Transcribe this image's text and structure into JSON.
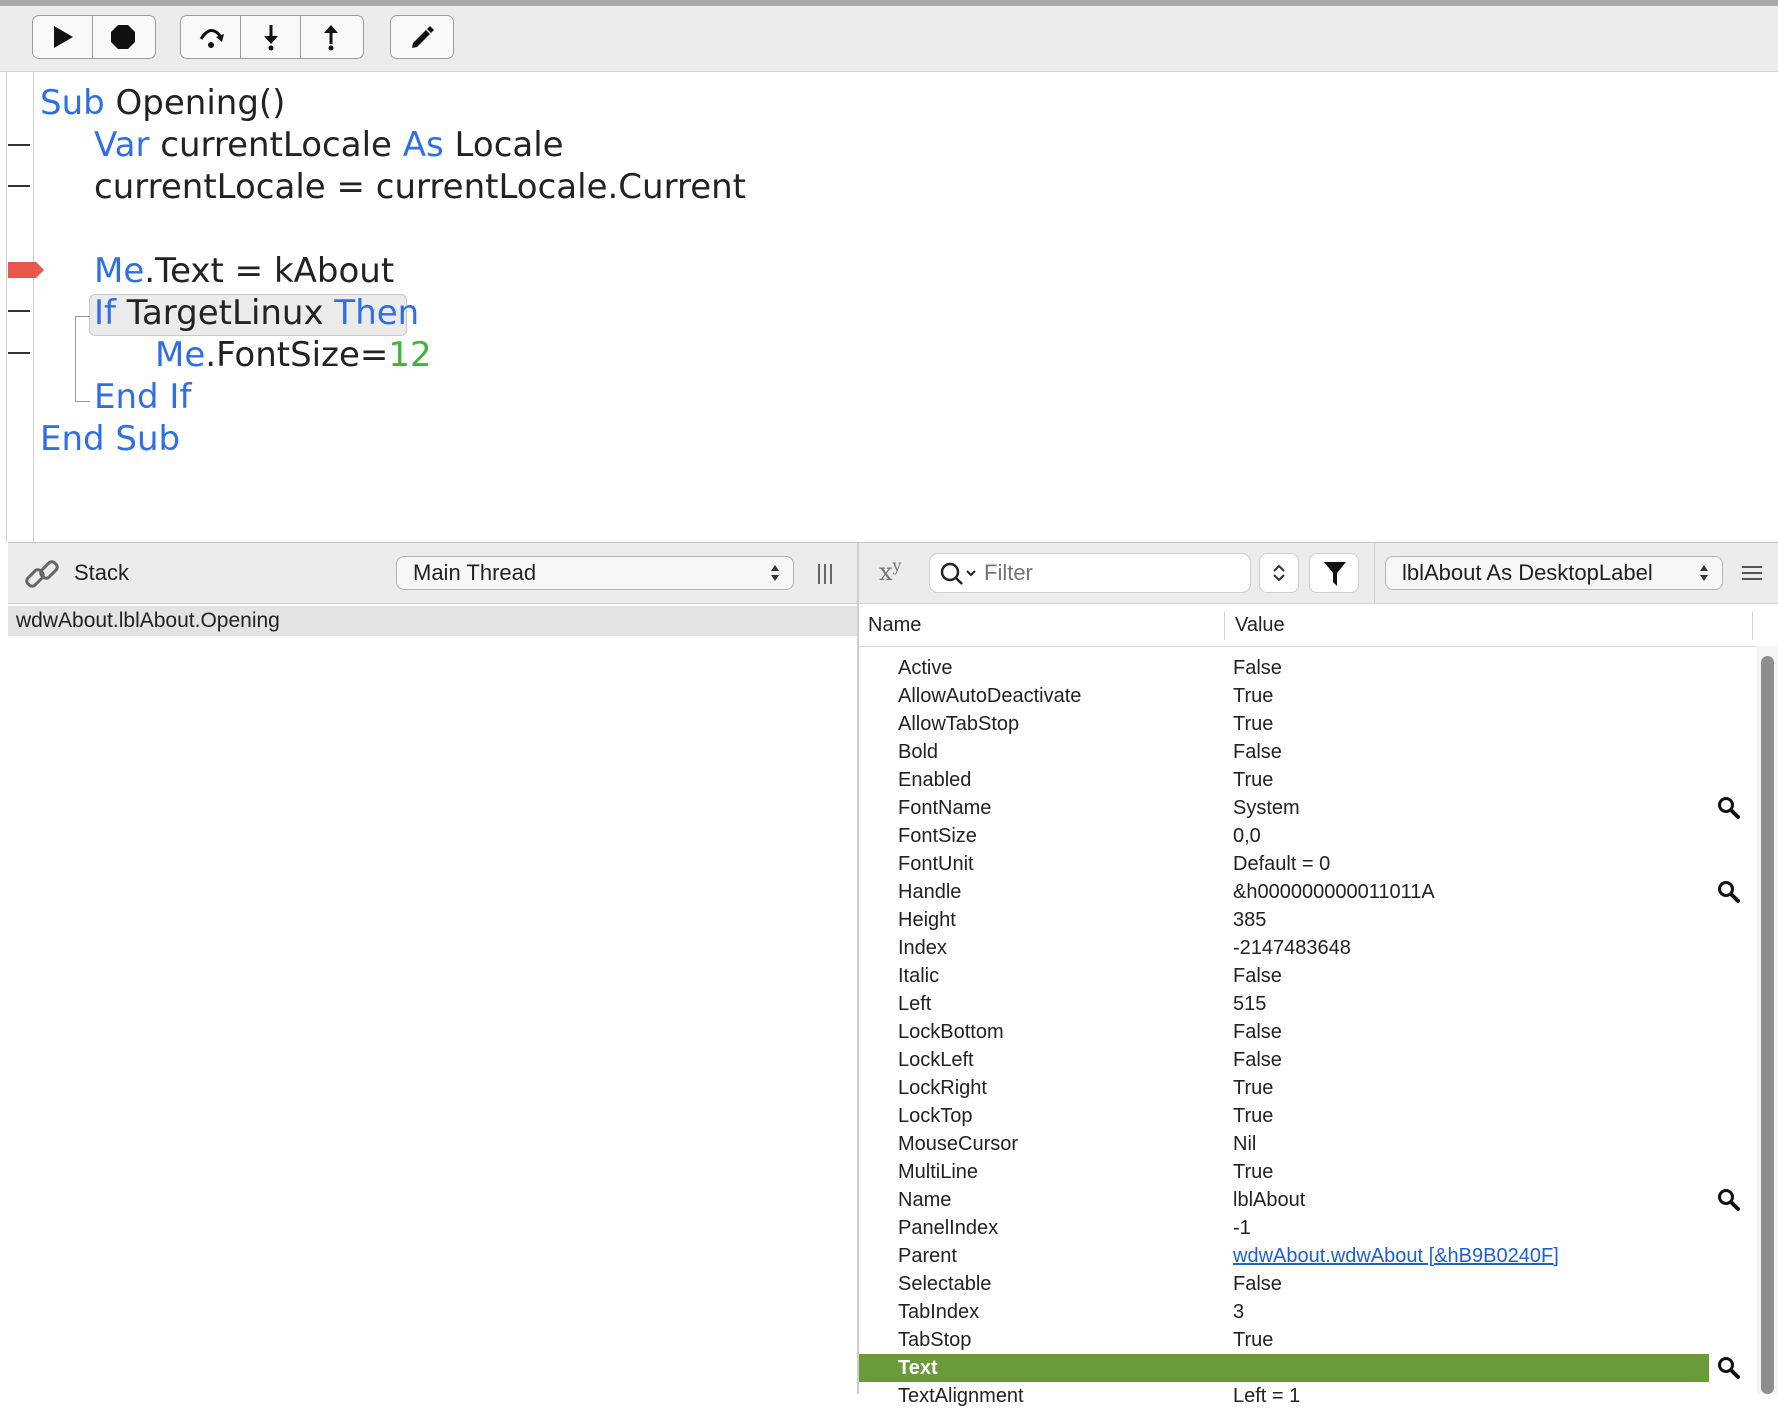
{
  "toolbar": {
    "buttons": [
      {
        "name": "run-button",
        "icon": "play-icon"
      },
      {
        "name": "stop-button",
        "icon": "stop-icon"
      },
      {
        "name": "step-over-button",
        "icon": "step-over-icon"
      },
      {
        "name": "step-in-button",
        "icon": "step-in-icon"
      },
      {
        "name": "step-out-button",
        "icon": "step-out-icon"
      },
      {
        "name": "edit-code-button",
        "icon": "pencil-icon"
      }
    ]
  },
  "code": {
    "l1_kw": "Sub",
    "l1_rest": " Opening()",
    "l2_kw1": "Var",
    "l2_mid": " currentLocale ",
    "l2_kw2": "As",
    "l2_rest": " Locale",
    "l3": "currentLocale = currentLocale.Current",
    "l5_kw": "Me",
    "l5_rest": ".Text = kAbout",
    "l6_kw1": "If",
    "l6_mid": " TargetLinux ",
    "l6_kw2": "Then",
    "l7_kw": "Me",
    "l7_rest": ".FontSize=",
    "l7_num": "12",
    "l8": "End If",
    "l9": "End Sub"
  },
  "stack": {
    "title": "Stack",
    "thread_selected": "Main Thread",
    "frames": [
      "wdwAbout.lblAbout.Opening"
    ]
  },
  "variables": {
    "xy_label": "x",
    "xy_sup": "y",
    "filter_placeholder": "Filter",
    "object_selected": "lblAbout As DesktopLabel",
    "col_name": "Name",
    "col_value": "Value",
    "rows": [
      {
        "name": "Active",
        "value": "False"
      },
      {
        "name": "AllowAutoDeactivate",
        "value": "True"
      },
      {
        "name": "AllowTabStop",
        "value": "True"
      },
      {
        "name": "Bold",
        "value": "False"
      },
      {
        "name": "Enabled",
        "value": "True"
      },
      {
        "name": "FontName",
        "value": "System"
      },
      {
        "name": "FontSize",
        "value": "0,0"
      },
      {
        "name": "FontUnit",
        "value": "Default = 0"
      },
      {
        "name": "Handle",
        "value": "&h000000000011011A"
      },
      {
        "name": "Height",
        "value": "385"
      },
      {
        "name": "Index",
        "value": "-2147483648"
      },
      {
        "name": "Italic",
        "value": "False"
      },
      {
        "name": "Left",
        "value": "515"
      },
      {
        "name": "LockBottom",
        "value": "False"
      },
      {
        "name": "LockLeft",
        "value": "False"
      },
      {
        "name": "LockRight",
        "value": "True"
      },
      {
        "name": "LockTop",
        "value": "True"
      },
      {
        "name": "MouseCursor",
        "value": "Nil"
      },
      {
        "name": "MultiLine",
        "value": "True"
      },
      {
        "name": "Name",
        "value": "lblAbout"
      },
      {
        "name": "PanelIndex",
        "value": "-1"
      },
      {
        "name": "Parent",
        "value": "wdwAbout.wdwAbout [&hB9B0240F]"
      },
      {
        "name": "Selectable",
        "value": "False"
      },
      {
        "name": "TabIndex",
        "value": "3"
      },
      {
        "name": "TabStop",
        "value": "True"
      },
      {
        "name": "Text",
        "value": ""
      },
      {
        "name": "TextAlignment",
        "value": "Left = 1"
      }
    ]
  },
  "colors": {
    "keyword": "#2f6ee6",
    "number": "#3bb83b",
    "selected_row": "#6a9a3a",
    "breakpoint": "#e8574c",
    "link": "#1f5fd1"
  }
}
